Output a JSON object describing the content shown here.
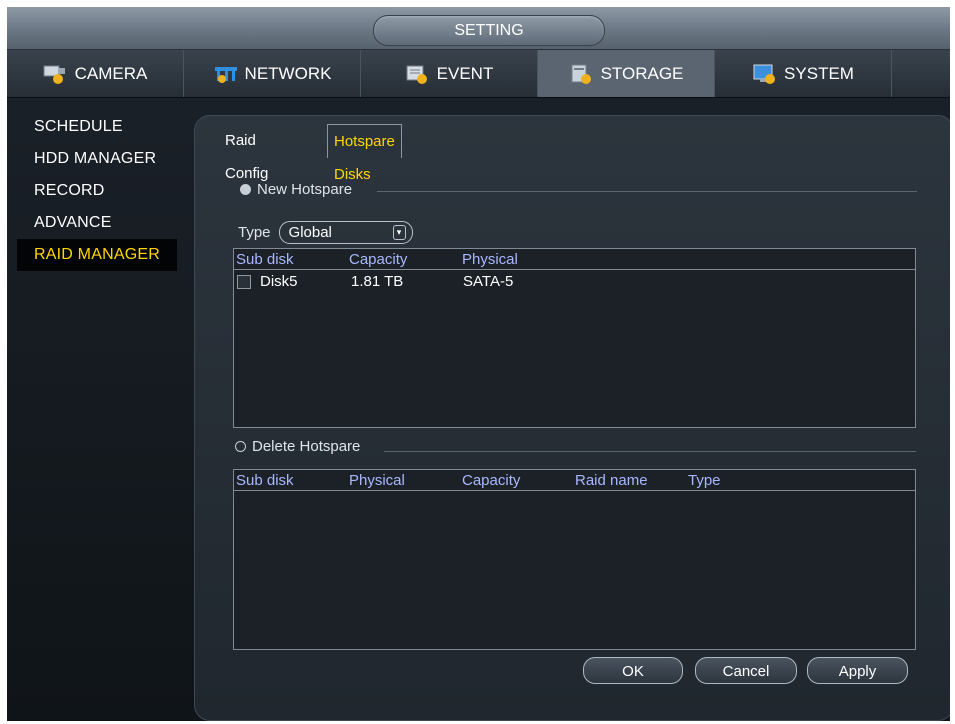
{
  "window": {
    "title": "SETTING"
  },
  "top_tabs": [
    {
      "label": "CAMERA",
      "icon": "camera-icon"
    },
    {
      "label": "NETWORK",
      "icon": "network-icon"
    },
    {
      "label": "EVENT",
      "icon": "event-icon"
    },
    {
      "label": "STORAGE",
      "icon": "storage-icon",
      "active": true
    },
    {
      "label": "SYSTEM",
      "icon": "system-icon"
    }
  ],
  "sidebar": {
    "items": [
      {
        "label": "SCHEDULE"
      },
      {
        "label": "HDD MANAGER"
      },
      {
        "label": "RECORD"
      },
      {
        "label": "ADVANCE"
      },
      {
        "label": "RAID MANAGER",
        "active": true
      }
    ]
  },
  "sub_tabs": [
    {
      "label": "Raid Config"
    },
    {
      "label": "Hotspare Disks",
      "active": true
    }
  ],
  "new_hotspare": {
    "label": "New Hotspare",
    "selected": true,
    "type_label": "Type",
    "type_value": "Global",
    "table": {
      "headers": [
        "Sub disk",
        "Capacity",
        "Physical"
      ],
      "rows": [
        {
          "sub_disk": "Disk5",
          "capacity": "1.81 TB",
          "physical": "SATA-5",
          "checked": false
        }
      ]
    }
  },
  "delete_hotspare": {
    "label": "Delete Hotspare",
    "selected": false,
    "table": {
      "headers": [
        "Sub disk",
        "Physical",
        "Capacity",
        "Raid name",
        "Type"
      ],
      "rows": []
    }
  },
  "buttons": {
    "ok": "OK",
    "cancel": "Cancel",
    "apply": "Apply"
  },
  "colors": {
    "accent_yellow": "#ffd700",
    "header_blue": "#a9b7ff",
    "background": "#1c222a"
  }
}
